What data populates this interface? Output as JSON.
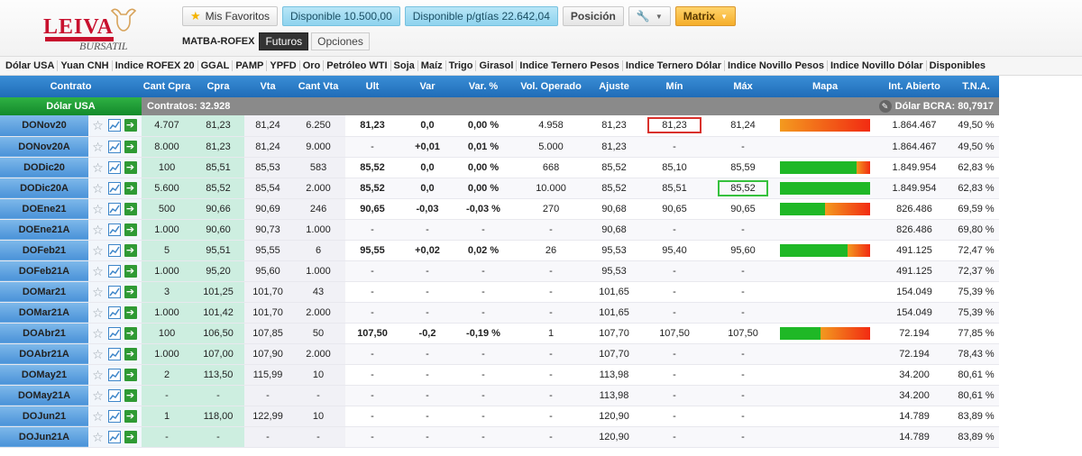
{
  "logo": {
    "brand": "LEIVA",
    "tagline": "BURSATIL"
  },
  "topbar": {
    "favoritos": "Mis Favoritos",
    "disponible": "Disponible 10.500,00",
    "disponible_garantias": "Disponible p/gtías 22.642,04",
    "posicion": "Posición",
    "matrix": "Matrix"
  },
  "subbar": {
    "exchange": "MATBA-ROFEX",
    "tabs": [
      "Futuros",
      "Opciones"
    ]
  },
  "categories": [
    "Dólar USA",
    "Yuan CNH",
    "Indice ROFEX 20",
    "GGAL",
    "PAMP",
    "YPFD",
    "Oro",
    "Petróleo WTI",
    "Soja",
    "Maíz",
    "Trigo",
    "Girasol",
    "Indice Ternero Pesos",
    "Indice Ternero Dólar",
    "Indice Novillo Pesos",
    "Indice Novillo Dólar",
    "Disponibles"
  ],
  "columns": [
    "Contrato",
    "Cant Cpra",
    "Cpra",
    "Vta",
    "Cant Vta",
    "Ult",
    "Var",
    "Var. %",
    "Vol. Operado",
    "Ajuste",
    "Mín",
    "Máx",
    "Mapa",
    "Int. Abierto",
    "T.N.A."
  ],
  "summary": {
    "name": "Dólar USA",
    "contratos": "Contratos: 32.928",
    "bcra": "Dólar BCRA: 80,7917"
  },
  "rows": [
    {
      "contrato": "DONov20",
      "cant_cpra": "4.707",
      "cpra": "81,23",
      "vta": "81,24",
      "cant_vta": "6.250",
      "ult": "81,23",
      "var": "0,0",
      "var_pct": "0,00 %",
      "vol": "4.958",
      "ajuste": "81,23",
      "min": "81,23",
      "max": "81,24",
      "int_abierto": "1.864.467",
      "tna": "49,50 %",
      "trend": "zero",
      "mapa": {
        "green": 0.0,
        "red": 1.0
      },
      "min_boxed": true
    },
    {
      "contrato": "DONov20A",
      "cant_cpra": "8.000",
      "cpra": "81,23",
      "vta": "81,24",
      "cant_vta": "9.000",
      "ult": "-",
      "var": "+0,01",
      "var_pct": "0,01 %",
      "vol": "5.000",
      "ajuste": "81,23",
      "min": "-",
      "max": "-",
      "int_abierto": "1.864.467",
      "tna": "49,50 %",
      "trend": "up"
    },
    {
      "contrato": "DODic20",
      "cant_cpra": "100",
      "cpra": "85,51",
      "vta": "85,53",
      "cant_vta": "583",
      "ult": "85,52",
      "var": "0,0",
      "var_pct": "0,00 %",
      "vol": "668",
      "ajuste": "85,52",
      "min": "85,10",
      "max": "85,59",
      "int_abierto": "1.849.954",
      "tna": "62,83 %",
      "trend": "zero",
      "mapa": {
        "green": 0.85,
        "red": 0.15
      }
    },
    {
      "contrato": "DODic20A",
      "cant_cpra": "5.600",
      "cpra": "85,52",
      "vta": "85,54",
      "cant_vta": "2.000",
      "ult": "85,52",
      "var": "0,0",
      "var_pct": "0,00 %",
      "vol": "10.000",
      "ajuste": "85,52",
      "min": "85,51",
      "max": "85,52",
      "int_abierto": "1.849.954",
      "tna": "62,83 %",
      "trend": "zero",
      "mapa": {
        "green": 1.0,
        "red": 0.0
      },
      "max_boxed": true
    },
    {
      "contrato": "DOEne21",
      "cant_cpra": "500",
      "cpra": "90,66",
      "vta": "90,69",
      "cant_vta": "246",
      "ult": "90,65",
      "var": "-0,03",
      "var_pct": "-0,03 %",
      "vol": "270",
      "ajuste": "90,68",
      "min": "90,65",
      "max": "90,65",
      "int_abierto": "826.486",
      "tna": "69,59 %",
      "trend": "down",
      "mapa": {
        "green": 0.5,
        "red": 0.5
      }
    },
    {
      "contrato": "DOEne21A",
      "cant_cpra": "1.000",
      "cpra": "90,60",
      "vta": "90,73",
      "cant_vta": "1.000",
      "ult": "-",
      "var": "-",
      "var_pct": "-",
      "vol": "-",
      "ajuste": "90,68",
      "min": "-",
      "max": "-",
      "int_abierto": "826.486",
      "tna": "69,80 %",
      "trend": "none"
    },
    {
      "contrato": "DOFeb21",
      "cant_cpra": "5",
      "cpra": "95,51",
      "vta": "95,55",
      "cant_vta": "6",
      "ult": "95,55",
      "var": "+0,02",
      "var_pct": "0,02 %",
      "vol": "26",
      "ajuste": "95,53",
      "min": "95,40",
      "max": "95,60",
      "int_abierto": "491.125",
      "tna": "72,47 %",
      "trend": "up",
      "mapa": {
        "green": 0.75,
        "red": 0.25
      }
    },
    {
      "contrato": "DOFeb21A",
      "cant_cpra": "1.000",
      "cpra": "95,20",
      "vta": "95,60",
      "cant_vta": "1.000",
      "ult": "-",
      "var": "-",
      "var_pct": "-",
      "vol": "-",
      "ajuste": "95,53",
      "min": "-",
      "max": "-",
      "int_abierto": "491.125",
      "tna": "72,37 %",
      "trend": "none"
    },
    {
      "contrato": "DOMar21",
      "cant_cpra": "3",
      "cpra": "101,25",
      "vta": "101,70",
      "cant_vta": "43",
      "ult": "-",
      "var": "-",
      "var_pct": "-",
      "vol": "-",
      "ajuste": "101,65",
      "min": "-",
      "max": "-",
      "int_abierto": "154.049",
      "tna": "75,39 %",
      "trend": "none"
    },
    {
      "contrato": "DOMar21A",
      "cant_cpra": "1.000",
      "cpra": "101,42",
      "vta": "101,70",
      "cant_vta": "2.000",
      "ult": "-",
      "var": "-",
      "var_pct": "-",
      "vol": "-",
      "ajuste": "101,65",
      "min": "-",
      "max": "-",
      "int_abierto": "154.049",
      "tna": "75,39 %",
      "trend": "none"
    },
    {
      "contrato": "DOAbr21",
      "cant_cpra": "100",
      "cpra": "106,50",
      "vta": "107,85",
      "cant_vta": "50",
      "ult": "107,50",
      "var": "-0,2",
      "var_pct": "-0,19 %",
      "vol": "1",
      "ajuste": "107,70",
      "min": "107,50",
      "max": "107,50",
      "int_abierto": "72.194",
      "tna": "77,85 %",
      "trend": "down",
      "mapa": {
        "green": 0.45,
        "red": 0.55
      }
    },
    {
      "contrato": "DOAbr21A",
      "cant_cpra": "1.000",
      "cpra": "107,00",
      "vta": "107,90",
      "cant_vta": "2.000",
      "ult": "-",
      "var": "-",
      "var_pct": "-",
      "vol": "-",
      "ajuste": "107,70",
      "min": "-",
      "max": "-",
      "int_abierto": "72.194",
      "tna": "78,43 %",
      "trend": "none"
    },
    {
      "contrato": "DOMay21",
      "cant_cpra": "2",
      "cpra": "113,50",
      "vta": "115,99",
      "cant_vta": "10",
      "ult": "-",
      "var": "-",
      "var_pct": "-",
      "vol": "-",
      "ajuste": "113,98",
      "min": "-",
      "max": "-",
      "int_abierto": "34.200",
      "tna": "80,61 %",
      "trend": "none"
    },
    {
      "contrato": "DOMay21A",
      "cant_cpra": "-",
      "cpra": "-",
      "vta": "-",
      "cant_vta": "-",
      "ult": "-",
      "var": "-",
      "var_pct": "-",
      "vol": "-",
      "ajuste": "113,98",
      "min": "-",
      "max": "-",
      "int_abierto": "34.200",
      "tna": "80,61 %",
      "trend": "none"
    },
    {
      "contrato": "DOJun21",
      "cant_cpra": "1",
      "cpra": "118,00",
      "vta": "122,99",
      "cant_vta": "10",
      "ult": "-",
      "var": "-",
      "var_pct": "-",
      "vol": "-",
      "ajuste": "120,90",
      "min": "-",
      "max": "-",
      "int_abierto": "14.789",
      "tna": "83,89 %",
      "trend": "none"
    },
    {
      "contrato": "DOJun21A",
      "cant_cpra": "-",
      "cpra": "-",
      "vta": "-",
      "cant_vta": "-",
      "ult": "-",
      "var": "-",
      "var_pct": "-",
      "vol": "-",
      "ajuste": "120,90",
      "min": "-",
      "max": "-",
      "int_abierto": "14.789",
      "tna": "83,89 %",
      "trend": "none"
    }
  ],
  "icons": {
    "favorite": "star-icon",
    "chart": "chart-icon",
    "order": "arrow-right-icon",
    "settings": "wrench-icon",
    "edit": "pencil-icon"
  },
  "colors": {
    "header_blue": "#1f6cb8",
    "contract_blue": "#4a92d8",
    "bid_green": "#cdeee0",
    "positive": "#178a2c",
    "negative": "#d22323",
    "level_blue": "#2b3cae",
    "map_green": "#1fb826",
    "map_red": "#f22b12",
    "matrix_orange": "#f5ae2a"
  }
}
